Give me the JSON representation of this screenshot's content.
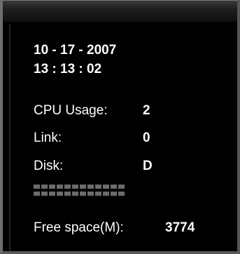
{
  "date": "10 - 17 - 2007",
  "time": "13 : 13 : 02",
  "stats": {
    "cpu_label": "CPU Usage:",
    "cpu_value": "2",
    "link_label": "Link:",
    "link_value": "0",
    "disk_label": "Disk:",
    "disk_value": "D"
  },
  "disk_meter": {
    "segments_per_row": 12,
    "rows": 2,
    "filled_fraction": 0.04,
    "filled_color": "#2a3cff",
    "empty_color": "#6b6b6b"
  },
  "free_space": {
    "label": "Free space(M):",
    "value": "3774"
  }
}
